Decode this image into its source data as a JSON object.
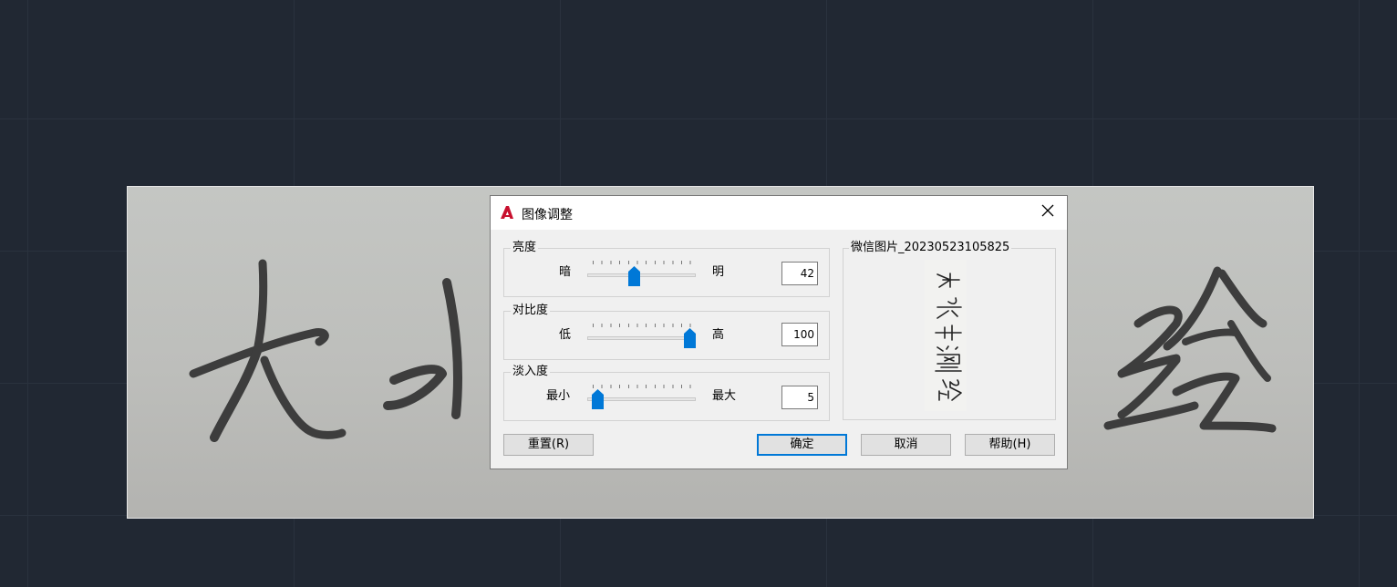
{
  "dialog": {
    "title": "图像调整",
    "app_icon": "autocad-logo-icon",
    "close_icon": "close-icon"
  },
  "brightness": {
    "group_label": "亮度",
    "min_label": "暗",
    "max_label": "明",
    "value": "42",
    "fraction": 0.42
  },
  "contrast": {
    "group_label": "对比度",
    "min_label": "低",
    "max_label": "高",
    "value": "100",
    "fraction": 1.0
  },
  "fade": {
    "group_label": "淡入度",
    "min_label": "最小",
    "max_label": "最大",
    "value": "5",
    "fraction": 0.05
  },
  "preview": {
    "group_label": "微信图片_20230523105825"
  },
  "buttons": {
    "reset": "重置(R)",
    "ok": "确定",
    "cancel": "取消",
    "help": "帮助(H)"
  },
  "colors": {
    "accent": "#0078d7",
    "canvas_bg": "#212833",
    "ink": "#3a3a3a"
  }
}
